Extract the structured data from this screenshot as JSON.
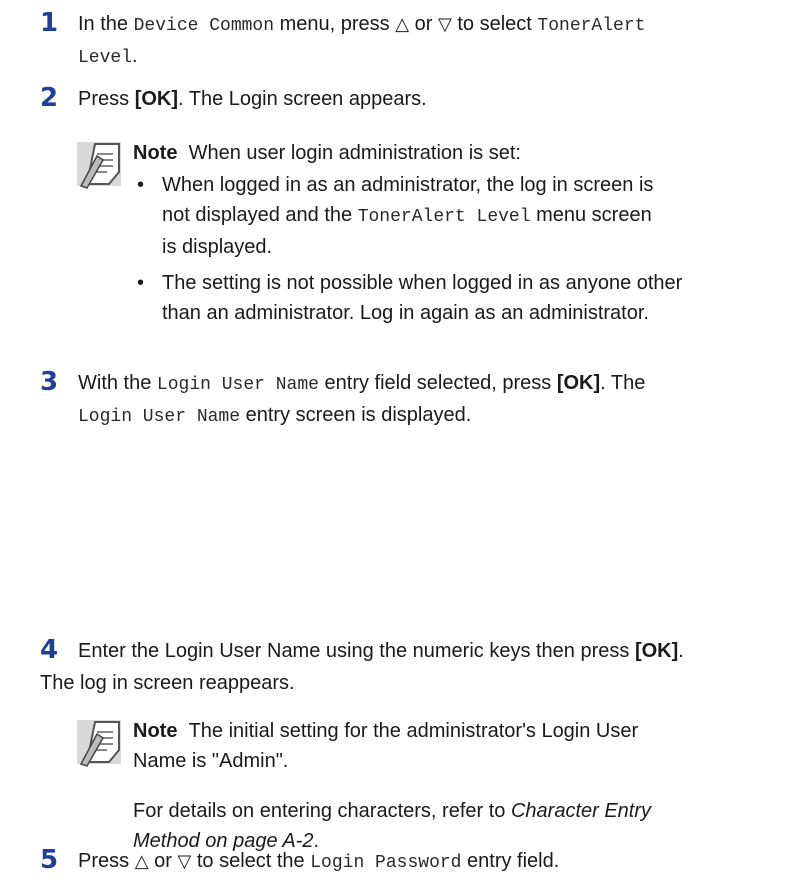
{
  "steps": [
    {
      "number": "1",
      "t1": "In the ",
      "c1": "Device Common",
      "t2": " menu, press ",
      "sym_up": "△",
      "t3": " or ",
      "sym_down": "▽",
      "t4": " to select ",
      "c2a": "TonerAlert",
      "c2b": "Level",
      "t5": "."
    },
    {
      "number": "2",
      "t1": "Press ",
      "ok": "[OK]",
      "t2": ". The Login screen appears."
    },
    {
      "number": "3",
      "t1": "With the ",
      "c1": "Login User Name",
      "t2": " entry field selected, press ",
      "ok": "[OK]",
      "t3": ". The",
      "c2": "Login User Name",
      "t4": " entry screen is displayed."
    },
    {
      "number": "4",
      "line1": "Enter the Login User Name using the numeric keys then press ",
      "ok": "[OK]",
      "t_end": ".",
      "line2": "The log in screen reappears."
    },
    {
      "number": "5",
      "t1": "Press ",
      "sym_up": "△",
      "t2": " or ",
      "sym_down": "▽",
      "t3": " to select the ",
      "c1": "Login Password",
      "t4": " entry field."
    }
  ],
  "note1": {
    "label": "Note",
    "intro": "When user login administration is set:",
    "b1_l1": "When logged in as an administrator, the log in screen is",
    "b1_l2a": "not displayed and the ",
    "b1_code": "TonerAlert Level",
    "b1_l2b": " menu screen",
    "b1_l3": "is displayed.",
    "b2_l1": "The setting is not possible when logged in as anyone other",
    "b2_l2": "than an administrator. Log in again as an administrator.",
    "bullet": "•"
  },
  "note2": {
    "label": "Note",
    "l1": "The initial setting for the administrator's Login User",
    "l2": "Name is \"Admin\".",
    "p2_l1a": "For details on entering characters, refer to ",
    "p2_l1b": "Character Entry",
    "p2_l2": "Method on page A-2",
    "p2_end": "."
  }
}
